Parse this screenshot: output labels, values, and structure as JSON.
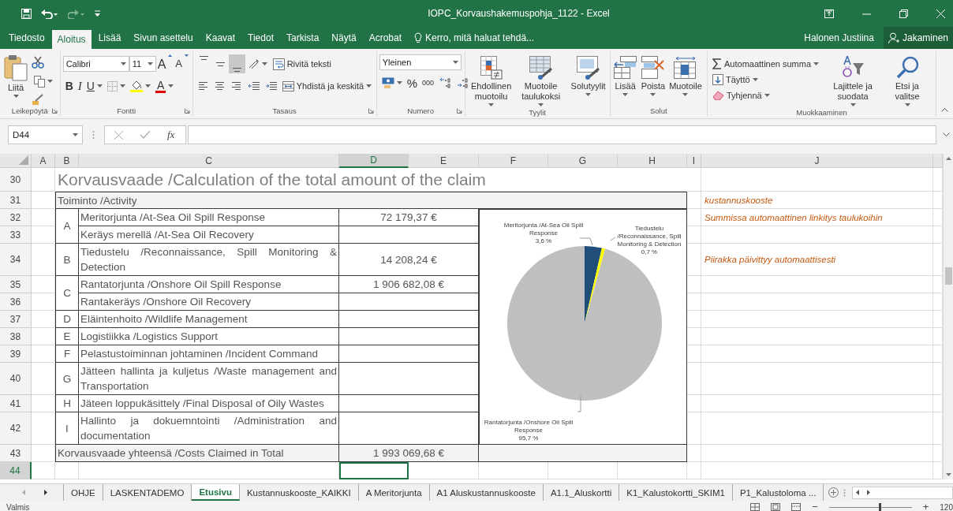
{
  "window": {
    "title": "IOPC_Korvaushakemuspohja_1122 - Excel"
  },
  "quick_access": [
    {
      "kind": "save",
      "disabled": false
    },
    {
      "kind": "undo",
      "disabled": false
    },
    {
      "kind": "redo",
      "disabled": true
    },
    {
      "kind": "customize",
      "disabled": false
    }
  ],
  "ribbon_tabs": [
    {
      "label": "Tiedosto",
      "selected": false
    },
    {
      "label": "Aloitus",
      "selected": true
    },
    {
      "label": "Lisää",
      "selected": false
    },
    {
      "label": "Sivun asettelu",
      "selected": false
    },
    {
      "label": "Kaavat",
      "selected": false
    },
    {
      "label": "Tiedot",
      "selected": false
    },
    {
      "label": "Tarkista",
      "selected": false
    },
    {
      "label": "Näytä",
      "selected": false
    },
    {
      "label": "Acrobat",
      "selected": false
    }
  ],
  "tell_me": {
    "placeholder": "Kerro, mitä haluat tehdä..."
  },
  "account": {
    "user": "Halonen Justiina",
    "share": "Jakaminen"
  },
  "ribbon_groups": [
    {
      "kind": "clipboard",
      "label": "Leikepöytä",
      "paste": "Liitä"
    },
    {
      "kind": "font",
      "label": "Fontti",
      "font": "Calibri",
      "size": "11",
      "grow": "A",
      "shrink": "A",
      "bold": "B",
      "italic": "I",
      "underline": "U",
      "font_color": "A"
    },
    {
      "kind": "alignment",
      "label": "Tasaus",
      "vertical_align": [
        {
          "selected": false
        },
        {
          "selected": false
        },
        {
          "selected": true
        }
      ],
      "wrap": "Rivitä teksti",
      "merge": "Yhdistä ja keskitä"
    },
    {
      "kind": "number",
      "label": "Numero",
      "format": "Yleinen",
      "percent": "%",
      "thousands": "000"
    },
    {
      "kind": "styles",
      "label": "Tyylit",
      "buttons": [
        "Ehdollinen muotoilu",
        "Muotoile taulukoksi",
        "Solutyylit"
      ]
    },
    {
      "kind": "cells",
      "label": "Solut",
      "buttons": [
        "Lisää",
        "Poista",
        "Muotoile"
      ]
    },
    {
      "kind": "editing",
      "label": "Muokkaaminen",
      "small": [
        "Automaattinen summa",
        "Täyttö",
        "Tyhjennä"
      ],
      "big": [
        "Lajittele ja suodata",
        "Etsi ja valitse"
      ]
    }
  ],
  "formula_bar": {
    "name_box": "D44",
    "fx": "fx"
  },
  "sheet": {
    "columns": [
      {
        "label": "A",
        "selected": false
      },
      {
        "label": "B",
        "selected": false
      },
      {
        "label": "C",
        "selected": false
      },
      {
        "label": "D",
        "selected": true
      },
      {
        "label": "E",
        "selected": false
      },
      {
        "label": "F",
        "selected": false
      },
      {
        "label": "G",
        "selected": false
      },
      {
        "label": "H",
        "selected": false
      },
      {
        "label": "I",
        "selected": false
      },
      {
        "label": "J",
        "selected": false
      }
    ],
    "rows": [
      {
        "header": "30",
        "selected": false,
        "kind": "title",
        "text": "Korvausvaade /Calculation of the total amount of the claim"
      },
      {
        "header": "31",
        "selected": false,
        "kind": "table_header",
        "text": "Toiminto /Activity",
        "note": "kustannuskooste"
      },
      {
        "header": "32",
        "selected": false,
        "kind": "item",
        "code": "A",
        "activity": "Meritorjunta /At-Sea Oil Spill Response",
        "amount": "72 179,37 €",
        "note": "Summissa automaattinen linkitys taulukoihin"
      },
      {
        "header": "33",
        "selected": false,
        "kind": "item",
        "activity": "Keräys merellä /At-Sea Oil Recovery"
      },
      {
        "header": "34",
        "selected": false,
        "kind": "item",
        "code": "B",
        "activity": "Tiedustelu /Reconnaissance, Spill Monitoring & Detection",
        "amount": "14 208,24 €",
        "note": "Piirakka päivittyy automaattisesti"
      },
      {
        "header": "35",
        "selected": false,
        "kind": "item",
        "code": "C",
        "activity": "Rantatorjunta /Onshore Oil Spill Response",
        "amount": "1 906 682,08 €"
      },
      {
        "header": "36",
        "selected": false,
        "kind": "item",
        "activity": "Rantakeräys /Onshore Oil Recovery"
      },
      {
        "header": "37",
        "selected": false,
        "kind": "item",
        "code": "D",
        "activity": "Eläintenhoito /Wildlife Management"
      },
      {
        "header": "38",
        "selected": false,
        "kind": "item",
        "code": "E",
        "activity": "Logistiikka /Logistics Support"
      },
      {
        "header": "39",
        "selected": false,
        "kind": "item",
        "code": "F",
        "activity": "Pelastustoiminnan johtaminen /Incident Command"
      },
      {
        "header": "40",
        "selected": false,
        "kind": "item",
        "code": "G",
        "activity": "Jätteen hallinta ja kuljetus /Waste management and Transportation"
      },
      {
        "header": "41",
        "selected": false,
        "kind": "item",
        "code": "H",
        "activity": "Jäteen loppukäsittely /Final Disposal of Oily Wastes"
      },
      {
        "header": "42",
        "selected": false,
        "kind": "item",
        "code": "I",
        "activity": "Hallinto ja dokuemntointi /Administration and documentation"
      },
      {
        "header": "43",
        "selected": false,
        "kind": "total",
        "text": "Korvausvaade yhteensä /Costs Claimed in Total",
        "amount": "1 993 069,68 €"
      },
      {
        "header": "44",
        "selected": true,
        "kind": "empty"
      }
    ],
    "chart_data": {
      "type": "pie",
      "categories": [
        "Meritorjunta /At-Sea Oil Spill Response",
        "Tiedustelu /Reconnaissance, Spill Monitoring & Detection",
        "Rantatorjunta /Onshore Oil Spill Response"
      ],
      "values": [
        3.6,
        0.7,
        95.7
      ],
      "value_labels": [
        "3,6 %",
        "0,7 %",
        "95,7 %"
      ],
      "data_labels": true
    }
  },
  "sheet_tabs": [
    {
      "label": "OHJE",
      "selected": false
    },
    {
      "label": "LASKENTADEMO",
      "selected": false
    },
    {
      "label": "Etusivu",
      "selected": true
    },
    {
      "label": "Kustannuskooste_KAIKKI",
      "selected": false
    },
    {
      "label": "A Meritorjunta",
      "selected": false
    },
    {
      "label": "A1 Aluskustannuskooste",
      "selected": false
    },
    {
      "label": "A1.1_Aluskortti",
      "selected": false
    },
    {
      "label": "K1_Kalustokortti_SKIM1",
      "selected": false
    },
    {
      "label": "P1_Kalustoloma ...",
      "selected": false
    }
  ],
  "status_bar": {
    "status": "Valmis",
    "zoom_out": "−",
    "zoom_in": "+",
    "zoom": {
      "level": 0.6,
      "reading": "120"
    }
  }
}
